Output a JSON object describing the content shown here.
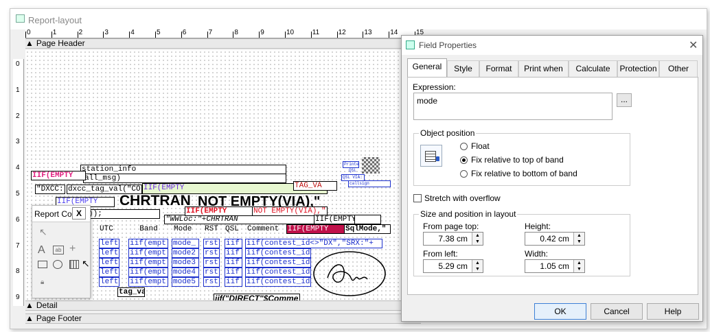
{
  "window": {
    "title": "Report-layout"
  },
  "ruler": {
    "h_marks": [
      "0",
      "1",
      "2",
      "3",
      "4",
      "5",
      "6",
      "7",
      "8",
      "9",
      "10",
      "11",
      "12",
      "13",
      "14",
      "15"
    ],
    "v_marks": [
      "0",
      "1",
      "2",
      "3",
      "4",
      "5",
      "6",
      "7",
      "8",
      "9"
    ]
  },
  "bands": {
    "page_header": "Page Header",
    "detail": "Detail",
    "page_footer": "Page Footer"
  },
  "fields": {
    "station_info": "station_info",
    "all_msg": "all_msg)",
    "dxcc_label": "\"DXCC:\"",
    "dxcc_val": "dxcc_tag_val(\"CO",
    "iif_empty": "IIF(EMPTY",
    "chrtran": "CHRTRAN",
    "not_empty_via": "NOT EMPTY(VIA),\"",
    "paren_tail": "));",
    "wwloc": "\"WWLoc:\"+CHRTRAN",
    "iif_empty2": "IIF(EMPTY",
    "iif_empty3": "IIF(EMPTY",
    "not_empty_upper": "NOT EMPTY(VIA),\"",
    "tag_val_top": "TAG_VA",
    "col_utc": "UTC",
    "col_band": "Band",
    "col_mode": "Mode",
    "col_rst": "RST",
    "col_qsl": "QSL",
    "col_comment": "Comment",
    "sqlmode": "SqlMode,\"",
    "left_rows": [
      "left(",
      "left(",
      "left(",
      "left(",
      "left("
    ],
    "iif_empt_rows": [
      "iif(empt",
      "iif(empt",
      "iif(empt",
      "iif(empt",
      "iif(empt"
    ],
    "mode_rows": [
      "mode_",
      "mode2",
      "mode3",
      "mode4",
      "mode5"
    ],
    "rst_rows": [
      "rst",
      "rst",
      "rst",
      "rst",
      "rst"
    ],
    "iif_short_rows": [
      "iif",
      "iif",
      "iif",
      "iif",
      "iif"
    ],
    "contest_row1": "iif(contest_id<>\"DX\",\"SRX:\"+",
    "contest_rows": [
      "iif(contest_id",
      "iif(contest_id",
      "iif(contest_id",
      "iif(contest_id"
    ],
    "tag_val": "tag_val",
    "direct_comm": "iif(\"DIRECT\"$Comme",
    "qsl_small_1": "Printed",
    "qsl_small_2": "QSL",
    "qsl_small_3": "QSL VIA:",
    "qsl_small_4": "callsign"
  },
  "toolbox": {
    "title": "Report Co",
    "close": "X"
  },
  "dialog": {
    "title": "Field Properties",
    "tabs": [
      "General",
      "Style",
      "Format",
      "Print when",
      "Calculate",
      "Protection",
      "Other"
    ],
    "expression_label": "Expression:",
    "expression_value": "mode",
    "browse_button": "...",
    "object_position_legend": "Object position",
    "float_label": "Float",
    "fix_top_label": "Fix relative to top of band",
    "fix_bottom_label": "Fix relative to bottom of band",
    "stretch_label": "Stretch with overflow",
    "size_pos_legend": "Size and position in layout",
    "from_top_label": "From page top:",
    "from_top_value": "7.38 cm",
    "height_label": "Height:",
    "height_value": "0.42 cm",
    "from_left_label": "From left:",
    "from_left_value": "5.29 cm",
    "width_label": "Width:",
    "width_value": "1.05 cm",
    "ok": "OK",
    "cancel": "Cancel",
    "help": "Help"
  }
}
